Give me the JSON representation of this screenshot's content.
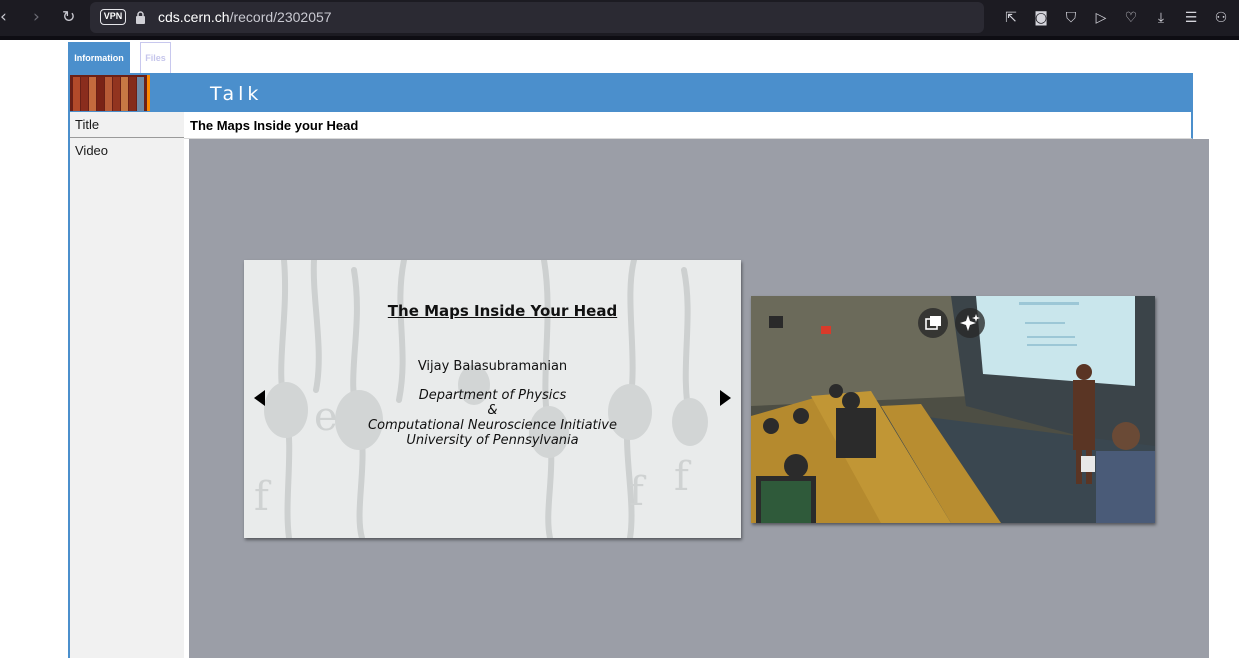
{
  "browser": {
    "vpn_badge": "VPN",
    "url_host": "cds.cern.ch",
    "url_path": "/record/2302057",
    "icons": [
      "back-icon",
      "forward-icon",
      "reload-icon",
      "lock-icon",
      "share-icon",
      "camera-icon",
      "shield-icon",
      "play-icon",
      "heart-icon",
      "download-icon",
      "menu-icon",
      "profile-icon"
    ]
  },
  "tabs": {
    "information": "Information",
    "files": "Files"
  },
  "header": {
    "title": "Talk"
  },
  "record": {
    "title_label": "Title",
    "title_value": "The Maps Inside your Head",
    "video_label": "Video"
  },
  "slide": {
    "heading": "The Maps Inside Your Head",
    "author": "Vijay Balasubramanian",
    "department": "Department of Physics",
    "ampersand": "&",
    "institute": "Computational Neuroscience Initiative",
    "university": "University of Pennsylvania"
  },
  "colors": {
    "accent": "#4b8fcc",
    "video_bg": "#9b9ea7",
    "browser_bg": "#1c1b22"
  }
}
